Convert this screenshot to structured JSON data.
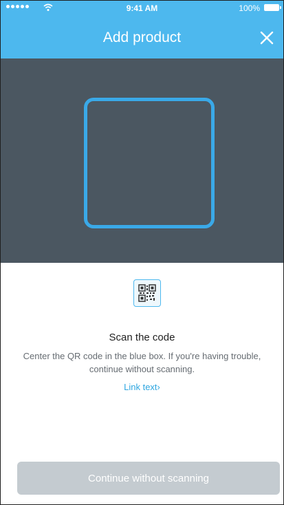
{
  "status_bar": {
    "time": "9:41 AM",
    "battery_percent": "100%"
  },
  "header": {
    "title": "Add product"
  },
  "scan": {
    "heading": "Scan the code",
    "description": "Center the QR code in the blue box. If you're having trouble, continue without scanning.",
    "link_text": "Link text›"
  },
  "footer": {
    "continue_label": "Continue without scanning"
  },
  "colors": {
    "header_bg": "#4db8ee",
    "scanner_bg": "#4b5761",
    "accent": "#3aa9e8",
    "button_disabled": "#c4cbd0"
  }
}
